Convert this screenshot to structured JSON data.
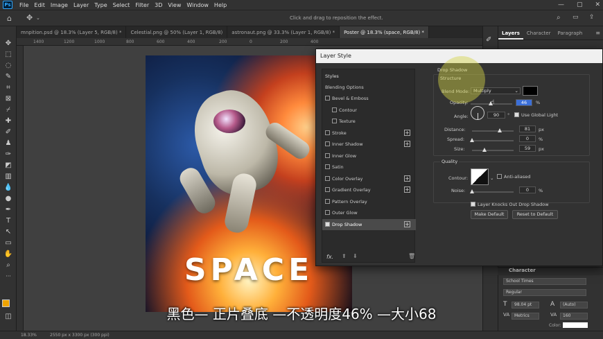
{
  "menu": {
    "items": [
      "File",
      "Edit",
      "Image",
      "Layer",
      "Type",
      "Select",
      "Filter",
      "3D",
      "View",
      "Window",
      "Help"
    ]
  },
  "options_bar": {
    "hint": "Click and drag to reposition the effect."
  },
  "doc_tabs": [
    "mnpition.psd @ 18.3% (Layer 5, RGB/8) *",
    "Celestial.png @ 50% (Layer 1, RGB/8)",
    "astronaut.png @ 33.3% (Layer 1, RGB/8) *",
    "Poster @ 18.3% (space, RGB/8) *"
  ],
  "ruler": [
    "1400",
    "1200",
    "1000",
    "800",
    "600",
    "400",
    "200",
    "0",
    "200",
    "400"
  ],
  "poster": {
    "title": "SPACE"
  },
  "panels": {
    "tabs": [
      "Layers",
      "Character",
      "Paragraph"
    ]
  },
  "dialog": {
    "title": "Layer Style",
    "styles_header": "Styles",
    "styles": [
      "Blending Options",
      "Bevel & Emboss",
      "Contour",
      "Texture",
      "Stroke",
      "Inner Shadow",
      "Inner Glow",
      "Satin",
      "Color Overlay",
      "Gradient Overlay",
      "Pattern Overlay",
      "Outer Glow",
      "Drop Shadow"
    ],
    "fx_label": "fx.",
    "section": "Drop Shadow",
    "structure": "Structure",
    "blend_mode_label": "Blend Mode:",
    "blend_mode": "Multiply",
    "opacity_label": "Opacity:",
    "opacity": "46",
    "angle_label": "Angle:",
    "angle": "90",
    "use_global_light": "Use Global Light",
    "distance_label": "Distance:",
    "distance": "81",
    "spread_label": "Spread:",
    "spread": "0",
    "size_label": "Size:",
    "size": "59",
    "quality": "Quality",
    "contour_label": "Contour:",
    "anti_aliased": "Anti-aliased",
    "noise_label": "Noise:",
    "noise": "0",
    "knockout": "Layer Knocks Out Drop Shadow",
    "make_default": "Make Default",
    "reset_default": "Reset to Default",
    "unit_pct": "%",
    "unit_px": "px",
    "unit_deg": "°",
    "shadow_color": "#000000"
  },
  "character": {
    "title": "Character",
    "font": "School Times",
    "style": "Regular",
    "size": "98.04 pt",
    "leading": "(Auto)",
    "kerning": "Metrics",
    "tracking": "160",
    "color_label": "Color:"
  },
  "status": {
    "zoom": "18.33%",
    "size": "2550 px x 3300 px (300 ppi)"
  },
  "subtitle": "黑色— 正片叠底 —不透明度46% —大小68"
}
